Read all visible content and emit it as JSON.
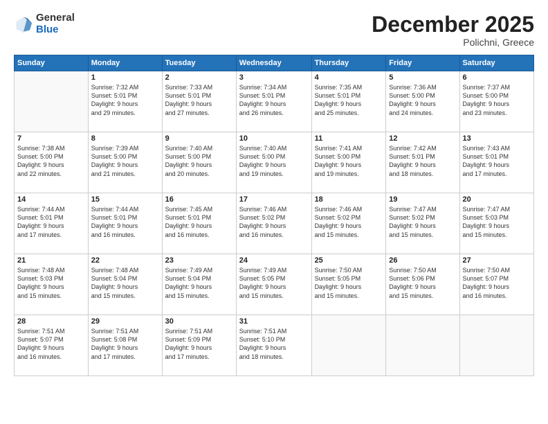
{
  "logo": {
    "general": "General",
    "blue": "Blue"
  },
  "title": {
    "month": "December 2025",
    "location": "Polichni, Greece"
  },
  "days_of_week": [
    "Sunday",
    "Monday",
    "Tuesday",
    "Wednesday",
    "Thursday",
    "Friday",
    "Saturday"
  ],
  "weeks": [
    [
      {
        "day": "",
        "info": ""
      },
      {
        "day": "1",
        "info": "Sunrise: 7:32 AM\nSunset: 5:01 PM\nDaylight: 9 hours\nand 29 minutes."
      },
      {
        "day": "2",
        "info": "Sunrise: 7:33 AM\nSunset: 5:01 PM\nDaylight: 9 hours\nand 27 minutes."
      },
      {
        "day": "3",
        "info": "Sunrise: 7:34 AM\nSunset: 5:01 PM\nDaylight: 9 hours\nand 26 minutes."
      },
      {
        "day": "4",
        "info": "Sunrise: 7:35 AM\nSunset: 5:01 PM\nDaylight: 9 hours\nand 25 minutes."
      },
      {
        "day": "5",
        "info": "Sunrise: 7:36 AM\nSunset: 5:00 PM\nDaylight: 9 hours\nand 24 minutes."
      },
      {
        "day": "6",
        "info": "Sunrise: 7:37 AM\nSunset: 5:00 PM\nDaylight: 9 hours\nand 23 minutes."
      }
    ],
    [
      {
        "day": "7",
        "info": "Sunrise: 7:38 AM\nSunset: 5:00 PM\nDaylight: 9 hours\nand 22 minutes."
      },
      {
        "day": "8",
        "info": "Sunrise: 7:39 AM\nSunset: 5:00 PM\nDaylight: 9 hours\nand 21 minutes."
      },
      {
        "day": "9",
        "info": "Sunrise: 7:40 AM\nSunset: 5:00 PM\nDaylight: 9 hours\nand 20 minutes."
      },
      {
        "day": "10",
        "info": "Sunrise: 7:40 AM\nSunset: 5:00 PM\nDaylight: 9 hours\nand 19 minutes."
      },
      {
        "day": "11",
        "info": "Sunrise: 7:41 AM\nSunset: 5:00 PM\nDaylight: 9 hours\nand 19 minutes."
      },
      {
        "day": "12",
        "info": "Sunrise: 7:42 AM\nSunset: 5:01 PM\nDaylight: 9 hours\nand 18 minutes."
      },
      {
        "day": "13",
        "info": "Sunrise: 7:43 AM\nSunset: 5:01 PM\nDaylight: 9 hours\nand 17 minutes."
      }
    ],
    [
      {
        "day": "14",
        "info": "Sunrise: 7:44 AM\nSunset: 5:01 PM\nDaylight: 9 hours\nand 17 minutes."
      },
      {
        "day": "15",
        "info": "Sunrise: 7:44 AM\nSunset: 5:01 PM\nDaylight: 9 hours\nand 16 minutes."
      },
      {
        "day": "16",
        "info": "Sunrise: 7:45 AM\nSunset: 5:01 PM\nDaylight: 9 hours\nand 16 minutes."
      },
      {
        "day": "17",
        "info": "Sunrise: 7:46 AM\nSunset: 5:02 PM\nDaylight: 9 hours\nand 16 minutes."
      },
      {
        "day": "18",
        "info": "Sunrise: 7:46 AM\nSunset: 5:02 PM\nDaylight: 9 hours\nand 15 minutes."
      },
      {
        "day": "19",
        "info": "Sunrise: 7:47 AM\nSunset: 5:02 PM\nDaylight: 9 hours\nand 15 minutes."
      },
      {
        "day": "20",
        "info": "Sunrise: 7:47 AM\nSunset: 5:03 PM\nDaylight: 9 hours\nand 15 minutes."
      }
    ],
    [
      {
        "day": "21",
        "info": "Sunrise: 7:48 AM\nSunset: 5:03 PM\nDaylight: 9 hours\nand 15 minutes."
      },
      {
        "day": "22",
        "info": "Sunrise: 7:48 AM\nSunset: 5:04 PM\nDaylight: 9 hours\nand 15 minutes."
      },
      {
        "day": "23",
        "info": "Sunrise: 7:49 AM\nSunset: 5:04 PM\nDaylight: 9 hours\nand 15 minutes."
      },
      {
        "day": "24",
        "info": "Sunrise: 7:49 AM\nSunset: 5:05 PM\nDaylight: 9 hours\nand 15 minutes."
      },
      {
        "day": "25",
        "info": "Sunrise: 7:50 AM\nSunset: 5:05 PM\nDaylight: 9 hours\nand 15 minutes."
      },
      {
        "day": "26",
        "info": "Sunrise: 7:50 AM\nSunset: 5:06 PM\nDaylight: 9 hours\nand 15 minutes."
      },
      {
        "day": "27",
        "info": "Sunrise: 7:50 AM\nSunset: 5:07 PM\nDaylight: 9 hours\nand 16 minutes."
      }
    ],
    [
      {
        "day": "28",
        "info": "Sunrise: 7:51 AM\nSunset: 5:07 PM\nDaylight: 9 hours\nand 16 minutes."
      },
      {
        "day": "29",
        "info": "Sunrise: 7:51 AM\nSunset: 5:08 PM\nDaylight: 9 hours\nand 17 minutes."
      },
      {
        "day": "30",
        "info": "Sunrise: 7:51 AM\nSunset: 5:09 PM\nDaylight: 9 hours\nand 17 minutes."
      },
      {
        "day": "31",
        "info": "Sunrise: 7:51 AM\nSunset: 5:10 PM\nDaylight: 9 hours\nand 18 minutes."
      },
      {
        "day": "",
        "info": ""
      },
      {
        "day": "",
        "info": ""
      },
      {
        "day": "",
        "info": ""
      }
    ]
  ]
}
